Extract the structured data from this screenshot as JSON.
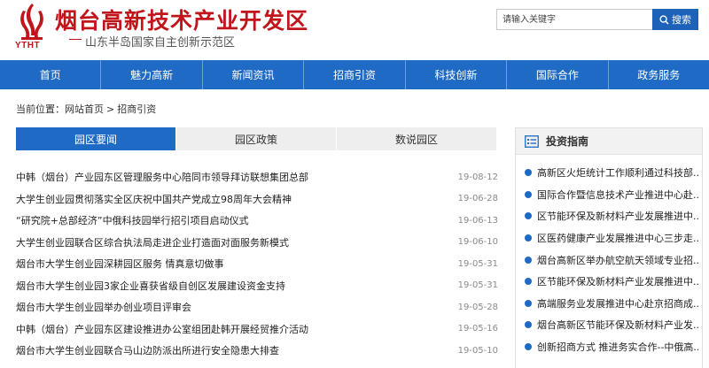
{
  "header": {
    "site_title": "烟台高新技术产业开发区",
    "site_subtitle": "山东半岛国家自主创新示范区",
    "logo_caption": "YTHT",
    "brand_color": "#c0151b",
    "search": {
      "placeholder": "请输入关键字",
      "button_label": "搜索",
      "button_icon": "search-icon"
    }
  },
  "nav": {
    "color": "#1e6ac4",
    "items": [
      {
        "label": "首页"
      },
      {
        "label": "魅力高新"
      },
      {
        "label": "新闻资讯"
      },
      {
        "label": "招商引资"
      },
      {
        "label": "科技创新"
      },
      {
        "label": "国际合作"
      },
      {
        "label": "政务服务"
      }
    ]
  },
  "breadcrumb": {
    "prefix": "当前位置：",
    "items": [
      "网站首页",
      "招商引资"
    ],
    "separator": ">"
  },
  "tabs": [
    {
      "label": "园区要闻",
      "active": true
    },
    {
      "label": "园区政策",
      "active": false
    },
    {
      "label": "数说园区",
      "active": false
    }
  ],
  "news": [
    {
      "title": "中韩（烟台）产业园东区管理服务中心陪同市领导拜访联想集团总部",
      "date": "19-08-12"
    },
    {
      "title": "大学生创业园贯彻落实全区庆祝中国共产党成立98周年大会精神",
      "date": "19-06-28"
    },
    {
      "title": "“研究院+总部经济”中俄科技园举行招引项目启动仪式",
      "date": "19-06-13"
    },
    {
      "title": "大学生创业园联合区综合执法局走进企业打造面对面服务新模式",
      "date": "19-06-10"
    },
    {
      "title": "烟台市大学生创业园深耕园区服务 情真意切做事",
      "date": "19-05-31"
    },
    {
      "title": "烟台市大学生创业园3家企业喜获省级自创区发展建设资金支持",
      "date": "19-05-31"
    },
    {
      "title": "烟台市大学生创业园举办创业项目评审会",
      "date": "19-05-28"
    },
    {
      "title": "中韩（烟台）产业园东区建设推进办公室组团赴韩开展经贸推介活动",
      "date": "19-05-16"
    },
    {
      "title": "烟台市大学生创业园联合马山边防派出所进行安全隐患大排查",
      "date": "19-05-10"
    }
  ],
  "side": {
    "title": "投资指南",
    "icon": "document-list-icon",
    "items": [
      "高新区火炬统计工作顺利通过科技部...",
      "国际合作暨信息技术产业推进中心赴...",
      "区节能环保及新材料产业发展推进中...",
      "区医药健康产业发展推进中心三步走...",
      "烟台高新区举办航空航天领域专业招...",
      "区节能环保及新材料产业发展推进中...",
      "高端服务业发展推进中心赴京招商成...",
      "烟台高新区节能环保及新材料产业发...",
      "创新招商方式 推进务实合作--中俄高..."
    ]
  }
}
